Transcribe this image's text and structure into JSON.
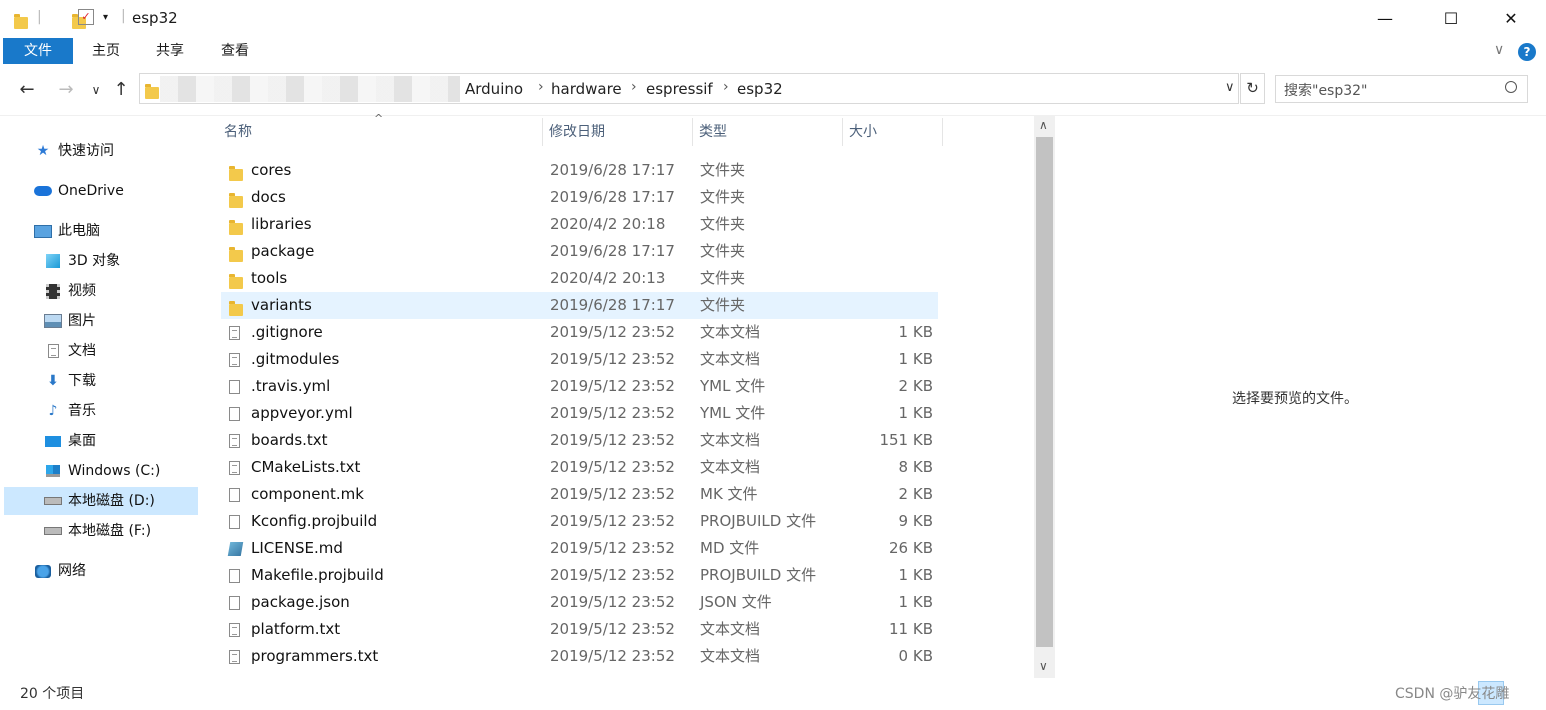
{
  "window": {
    "title": "esp32",
    "minimize": "—",
    "maximize": "☐",
    "close": "✕"
  },
  "ribbon": {
    "tabs": [
      "文件",
      "主页",
      "共享",
      "查看"
    ],
    "collapse": "∨",
    "help": "?"
  },
  "nav": {
    "back": "←",
    "forward": "→",
    "recent": "∨",
    "up": "↑"
  },
  "address": {
    "breadcrumbs": [
      "Arduino",
      "hardware",
      "espressif",
      "esp32"
    ],
    "separator": "›",
    "dropdown": "∨",
    "refresh": "↻"
  },
  "search": {
    "placeholder": "搜索\"esp32\"",
    "icon": "search-icon"
  },
  "sidebar": {
    "items": [
      {
        "label": "快速访问",
        "icon": "star-icon"
      },
      {
        "label": "OneDrive",
        "icon": "cloud-icon"
      },
      {
        "label": "此电脑",
        "icon": "computer-icon"
      },
      {
        "label": "3D 对象",
        "icon": "cube-icon"
      },
      {
        "label": "视频",
        "icon": "film-icon"
      },
      {
        "label": "图片",
        "icon": "picture-icon"
      },
      {
        "label": "文档",
        "icon": "document-icon"
      },
      {
        "label": "下载",
        "icon": "download-icon"
      },
      {
        "label": "音乐",
        "icon": "music-icon"
      },
      {
        "label": "桌面",
        "icon": "desktop-icon"
      },
      {
        "label": "Windows (C:)",
        "icon": "windows-drive-icon"
      },
      {
        "label": "本地磁盘 (D:)",
        "icon": "drive-icon"
      },
      {
        "label": "本地磁盘 (F:)",
        "icon": "drive-icon"
      },
      {
        "label": "网络",
        "icon": "network-icon"
      }
    ]
  },
  "columns": {
    "name": "名称",
    "date": "修改日期",
    "type": "类型",
    "size": "大小"
  },
  "files": [
    {
      "name": "cores",
      "date": "2019/6/28 17:17",
      "type": "文件夹",
      "size": "",
      "icon": "folder"
    },
    {
      "name": "docs",
      "date": "2019/6/28 17:17",
      "type": "文件夹",
      "size": "",
      "icon": "folder"
    },
    {
      "name": "libraries",
      "date": "2020/4/2 20:18",
      "type": "文件夹",
      "size": "",
      "icon": "folder"
    },
    {
      "name": "package",
      "date": "2019/6/28 17:17",
      "type": "文件夹",
      "size": "",
      "icon": "folder"
    },
    {
      "name": "tools",
      "date": "2020/4/2 20:13",
      "type": "文件夹",
      "size": "",
      "icon": "folder"
    },
    {
      "name": "variants",
      "date": "2019/6/28 17:17",
      "type": "文件夹",
      "size": "",
      "icon": "folder"
    },
    {
      "name": ".gitignore",
      "date": "2019/5/12 23:52",
      "type": "文本文档",
      "size": "1 KB",
      "icon": "text"
    },
    {
      "name": ".gitmodules",
      "date": "2019/5/12 23:52",
      "type": "文本文档",
      "size": "1 KB",
      "icon": "text"
    },
    {
      "name": ".travis.yml",
      "date": "2019/5/12 23:52",
      "type": "YML 文件",
      "size": "2 KB",
      "icon": "file"
    },
    {
      "name": "appveyor.yml",
      "date": "2019/5/12 23:52",
      "type": "YML 文件",
      "size": "1 KB",
      "icon": "file"
    },
    {
      "name": "boards.txt",
      "date": "2019/5/12 23:52",
      "type": "文本文档",
      "size": "151 KB",
      "icon": "text"
    },
    {
      "name": "CMakeLists.txt",
      "date": "2019/5/12 23:52",
      "type": "文本文档",
      "size": "8 KB",
      "icon": "text"
    },
    {
      "name": "component.mk",
      "date": "2019/5/12 23:52",
      "type": "MK 文件",
      "size": "2 KB",
      "icon": "file"
    },
    {
      "name": "Kconfig.projbuild",
      "date": "2019/5/12 23:52",
      "type": "PROJBUILD 文件",
      "size": "9 KB",
      "icon": "file"
    },
    {
      "name": "LICENSE.md",
      "date": "2019/5/12 23:52",
      "type": "MD 文件",
      "size": "26 KB",
      "icon": "md"
    },
    {
      "name": "Makefile.projbuild",
      "date": "2019/5/12 23:52",
      "type": "PROJBUILD 文件",
      "size": "1 KB",
      "icon": "file"
    },
    {
      "name": "package.json",
      "date": "2019/5/12 23:52",
      "type": "JSON 文件",
      "size": "1 KB",
      "icon": "file"
    },
    {
      "name": "platform.txt",
      "date": "2019/5/12 23:52",
      "type": "文本文档",
      "size": "11 KB",
      "icon": "text"
    },
    {
      "name": "programmers.txt",
      "date": "2019/5/12 23:52",
      "type": "文本文档",
      "size": "0 KB",
      "icon": "text"
    }
  ],
  "preview": {
    "message": "选择要预览的文件。"
  },
  "status": {
    "count": "20 个项目"
  },
  "watermark": "CSDN @驴友花雕"
}
